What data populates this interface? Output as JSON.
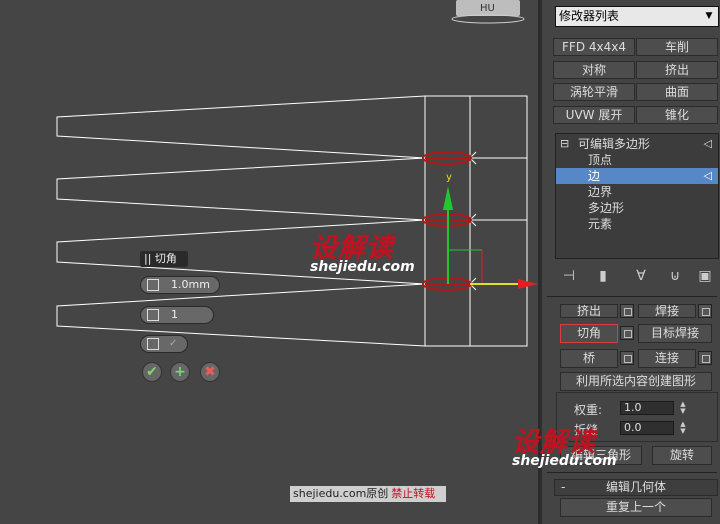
{
  "modifier_list": {
    "label": "修改器列表",
    "arrow": "▼"
  },
  "modifier_buttons": [
    "FFD 4x4x4",
    "车削",
    "对称",
    "挤出",
    "涡轮平滑",
    "曲面",
    "UVW 展开",
    "锥化"
  ],
  "stack": {
    "root": "可编辑多边形",
    "items": [
      "顶点",
      "边",
      "边界",
      "多边形",
      "元素"
    ],
    "selected_index": 1,
    "expand_glyph": "⊟"
  },
  "edit_edges": {
    "extrude_label": "挤出",
    "weld_label": "焊接",
    "chamfer_label": "切角",
    "target_weld_label": "目标焊接",
    "bridge_label": "桥",
    "connect_label": "连接",
    "create_shape_label": "利用所选内容创建图形",
    "weight_label": "权重:",
    "weight_value": "1.0",
    "crease_label": "折缝",
    "crease_value": "0.0",
    "edit_tri_label": "编辑三角形",
    "turn_label": "旋转"
  },
  "edit_geometry": {
    "collapse_glyph": "-",
    "title": "编辑几何体",
    "repeat_last_label": "重复上一个"
  },
  "caddy": {
    "title": "|| 切角",
    "amount_value": "1.0mm",
    "segments_value": "1",
    "ok_glyph": "✔",
    "apply_glyph": "+",
    "cancel_glyph": "✖"
  },
  "viewport": {
    "viewcube_label": "HU",
    "axis_label": "y"
  },
  "watermark": {
    "cn": "设解读",
    "en": "shejiedu.com"
  },
  "credit": {
    "text": "shejiedu.com原创",
    "warning": "禁止转载"
  },
  "colors": {
    "selection": "#5887c8",
    "axis_green": "#22c72d",
    "axis_red": "#e02020",
    "watermark_red": "#c1121f"
  }
}
